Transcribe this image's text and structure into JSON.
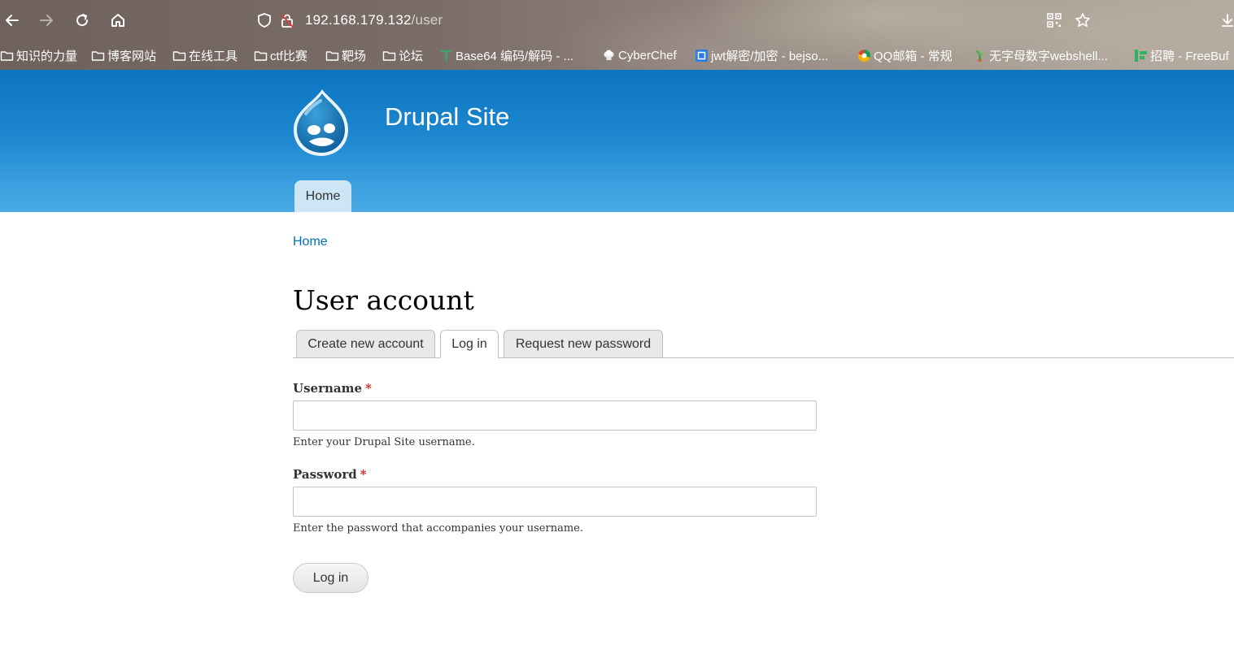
{
  "browser": {
    "url_host": "192.168.179.132",
    "url_path": "/user",
    "icons": [
      "back-icon",
      "forward-icon",
      "reload-icon",
      "home-icon",
      "shield-icon",
      "insecure-lock-icon",
      "qr-code-icon",
      "star-icon",
      "download-icon"
    ],
    "bookmarks": [
      {
        "label": "知识的力量",
        "icon": "folder-icon"
      },
      {
        "label": "博客网站",
        "icon": "folder-icon"
      },
      {
        "label": "在线工具",
        "icon": "folder-icon"
      },
      {
        "label": "ctf比赛",
        "icon": "folder-icon"
      },
      {
        "label": "靶场",
        "icon": "folder-icon"
      },
      {
        "label": "论坛",
        "icon": "folder-icon"
      },
      {
        "label": "Base64 编码/解码 - ...",
        "icon": "site-icon"
      },
      {
        "label": "CyberChef",
        "icon": "chef-icon"
      },
      {
        "label": "jwt解密/加密 - bejso...",
        "icon": "site-icon"
      },
      {
        "label": "QQ邮箱 - 常规",
        "icon": "qq-mail-icon"
      },
      {
        "label": "无字母数字webshell...",
        "icon": "plant-icon"
      },
      {
        "label": "招聘 - FreeBuf",
        "icon": "site-icon"
      }
    ]
  },
  "site": {
    "name": "Drupal Site",
    "main_menu": [
      "Home"
    ]
  },
  "breadcrumb": "Home",
  "page": {
    "title": "User account",
    "tabs": [
      {
        "label": "Create new account",
        "active": false
      },
      {
        "label": "Log in",
        "active": true
      },
      {
        "label": "Request new password",
        "active": false
      }
    ]
  },
  "form": {
    "username": {
      "label": "Username",
      "required_mark": "*",
      "value": "",
      "description": "Enter your Drupal Site username."
    },
    "password": {
      "label": "Password",
      "required_mark": "*",
      "value": "",
      "description": "Enter the password that accompanies your username."
    },
    "submit_label": "Log in"
  },
  "colors": {
    "header_top": "#0d75c0",
    "header_bottom": "#48a9e4",
    "link": "#0071b3",
    "required": "#cc2222"
  }
}
